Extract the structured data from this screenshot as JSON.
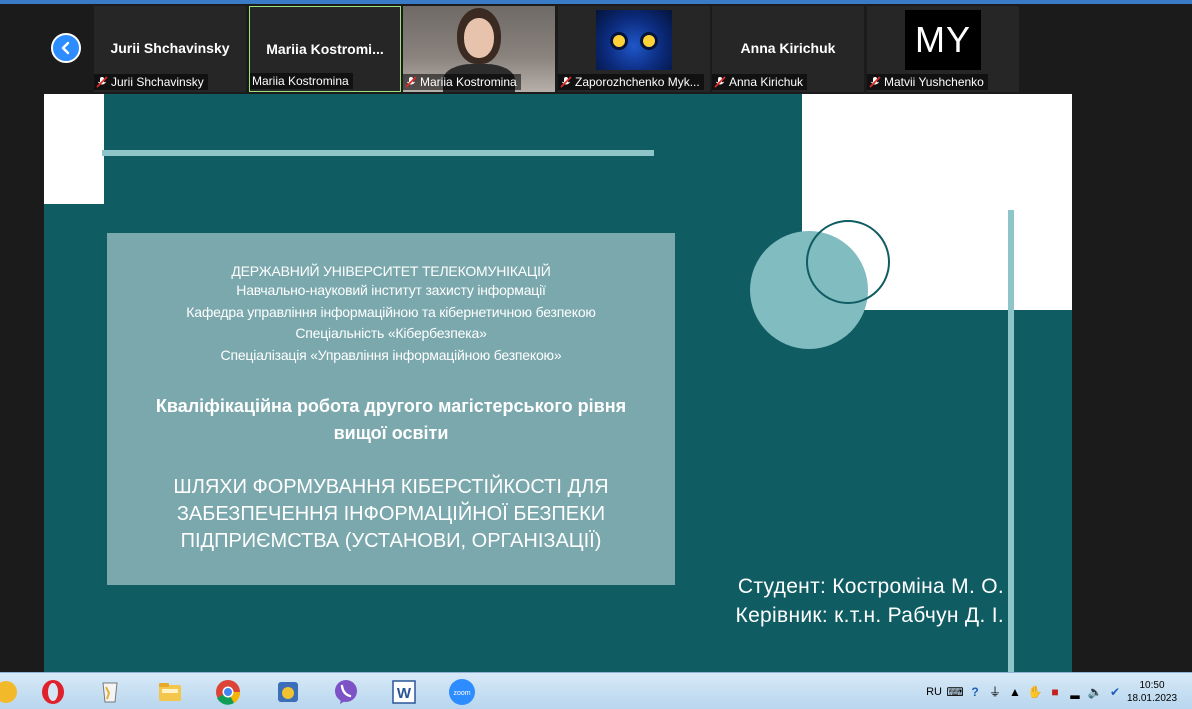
{
  "participants": [
    {
      "big_name": "Jurii Shchavinsky",
      "label": "Jurii Shchavinsky",
      "muted": true,
      "kind": "name"
    },
    {
      "big_name": "Mariia  Kostromi...",
      "label": "Mariia Kostromina",
      "muted": false,
      "kind": "name",
      "active": true
    },
    {
      "big_name": "",
      "label": "Mariia Kostromina",
      "muted": true,
      "kind": "camera"
    },
    {
      "big_name": "",
      "label": "Zaporozhchenko Myk...",
      "muted": true,
      "kind": "owl"
    },
    {
      "big_name": "Anna Kirichuk",
      "label": "Anna Kirichuk",
      "muted": true,
      "kind": "name"
    },
    {
      "big_name": "MY",
      "label": "Matvii Yushchenko",
      "muted": true,
      "kind": "initials"
    }
  ],
  "slide": {
    "lines": [
      "ДЕРЖАВНИЙ УНІВЕРСИТЕТ ТЕЛЕКОМУНІКАЦІЙ",
      "Навчально-науковий інститут захисту інформації",
      "Кафедра управління інформаційною та кібернетичною безпекою",
      "Спеціальність «Кібербезпека»",
      "Спеціалізація «Управління інформаційною безпекою»"
    ],
    "heading_1": "Кваліфікаційна робота другого магістерського рівня",
    "heading_2": "вищої освіти",
    "topic_1": "ШЛЯХИ ФОРМУВАННЯ КІБЕРСТІЙКОСТІ ДЛЯ",
    "topic_2": "ЗАБЕЗПЕЧЕННЯ ІНФОРМАЦІЙНОЇ БЕЗПЕКИ",
    "topic_3": "ПІДПРИЄМСТВА (УСТАНОВИ, ОРГАНІЗАЦІЇ)",
    "student": "Студент: Костроміна М. О.",
    "supervisor": "Керівник: к.т.н. Рабчун Д. І."
  },
  "taskbar": {
    "apps": [
      "opera-icon",
      "recycle-icon",
      "folder-icon",
      "chrome-icon",
      "app-icon",
      "viber-icon",
      "word-icon",
      "zoom-icon"
    ],
    "zoom_label": "zoom",
    "word_label": "W",
    "lang": "RU",
    "time": "10:50",
    "date": "18.01.2023"
  },
  "colors": {
    "slide_bg": "#0f5d63",
    "accent": "#8ec5c8",
    "textbox": "#7aa8ad",
    "zoom_blue": "#2d8cff"
  }
}
